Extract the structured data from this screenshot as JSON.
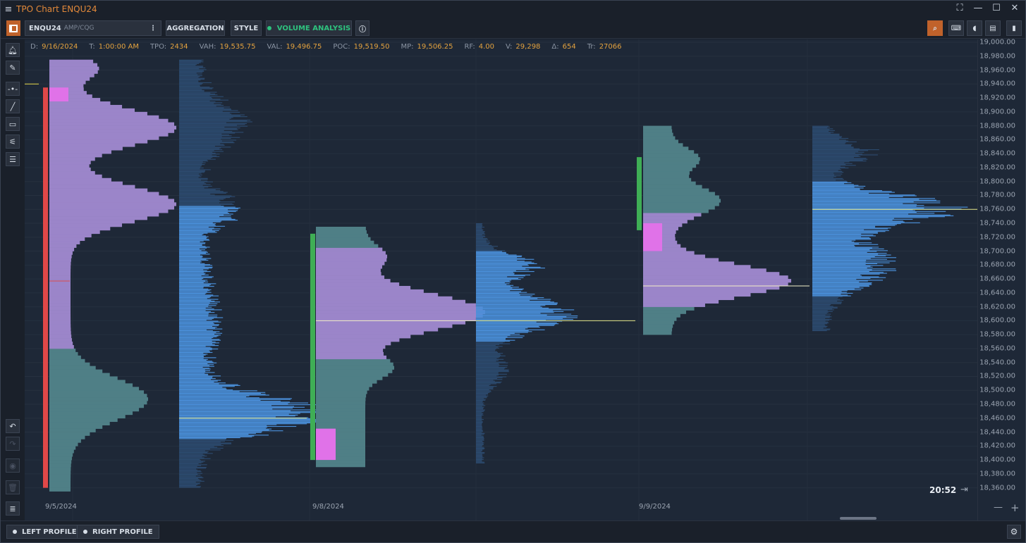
{
  "window": {
    "title": "TPO Chart ENQU24",
    "menu_icon": "hamburger-icon"
  },
  "toolbar": {
    "symbol": "ENQU24",
    "feed": "AMP/CQG",
    "aggregation_label": "AGGREGATION",
    "style_label": "STYLE",
    "volume_analysis_label": "VOLUME ANALYSIS",
    "accent": "#c0622b",
    "active_green": "#2ec27e"
  },
  "info": {
    "D": {
      "label": "D:",
      "value": "9/16/2024"
    },
    "T": {
      "label": "T:",
      "value": "1:00:00 AM"
    },
    "TPO": {
      "label": "TPO:",
      "value": "2434"
    },
    "VAH": {
      "label": "VAH:",
      "value": "19,535.75"
    },
    "VAL": {
      "label": "VAL:",
      "value": "19,496.75"
    },
    "POC": {
      "label": "POC:",
      "value": "19,519.50"
    },
    "MP": {
      "label": "MP:",
      "value": "19,506.25"
    },
    "RF": {
      "label": "RF:",
      "value": "4.00"
    },
    "V": {
      "label": "V:",
      "value": "29,298"
    },
    "Delta": {
      "label": "Δ:",
      "value": "654"
    },
    "Tr": {
      "label": "Tr:",
      "value": "27066"
    }
  },
  "price_axis": [
    "19,000.00",
    "18,980.00",
    "18,960.00",
    "18,940.00",
    "18,920.00",
    "18,900.00",
    "18,880.00",
    "18,860.00",
    "18,840.00",
    "18,820.00",
    "18,800.00",
    "18,780.00",
    "18,760.00",
    "18,740.00",
    "18,720.00",
    "18,700.00",
    "18,680.00",
    "18,660.00",
    "18,640.00",
    "18,620.00",
    "18,600.00",
    "18,580.00",
    "18,560.00",
    "18,540.00",
    "18,520.00",
    "18,500.00",
    "18,480.00",
    "18,460.00",
    "18,440.00",
    "18,420.00",
    "18,400.00",
    "18,380.00",
    "18,360.00"
  ],
  "date_labels": [
    "9/5/2024",
    "9/8/2024",
    "9/9/2024"
  ],
  "clock": "20:52",
  "bottom": {
    "left_profile_label": "LEFT PROFILE",
    "right_profile_label": "RIGHT PROFILE"
  },
  "profiles": [
    {
      "date": "9/5/2024",
      "range": [
        18360,
        18975
      ],
      "poc": 18460,
      "ib_color": "#e04848",
      "tpo_value_area": [
        18560,
        18975
      ],
      "tpo_outside_lower": [
        18360,
        18560
      ],
      "volume_value_area": [
        18430,
        18765
      ],
      "volume_poc": 18460
    },
    {
      "date": "9/8/2024",
      "range": [
        18390,
        18735
      ],
      "poc": 18600,
      "ib_color": "#3fae55",
      "tpo_value_area": [
        18545,
        18705
      ],
      "volume_value_area": [
        18570,
        18700
      ],
      "volume_poc": 18600
    },
    {
      "date": "9/9/2024",
      "range": [
        18580,
        18880
      ],
      "poc": 18650,
      "ib_color": "#3fae55",
      "tpo_value_area": [
        18620,
        18755
      ],
      "volume_value_area": [
        18635,
        18800
      ],
      "volume_poc": 18760
    }
  ]
}
